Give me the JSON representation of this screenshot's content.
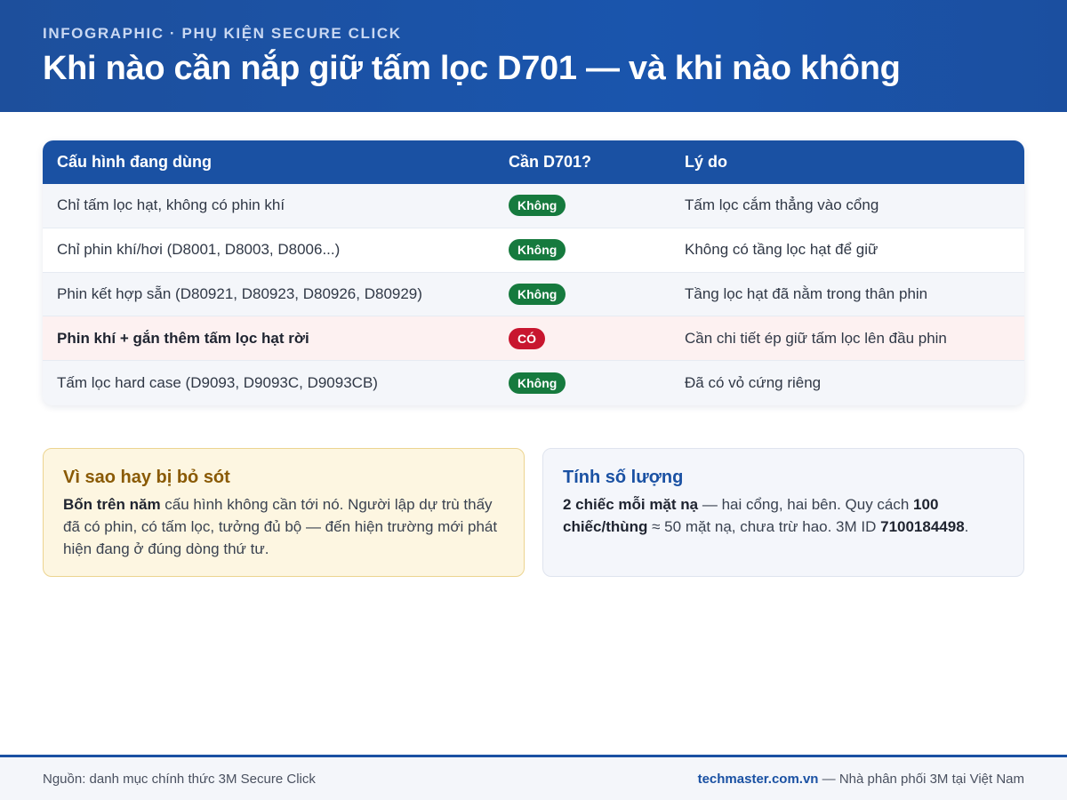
{
  "header": {
    "eyebrow": "INFOGRAPHIC · PHỤ KIỆN SECURE CLICK",
    "title": "Khi nào cần nắp giữ tấm lọc D701 — và khi nào không"
  },
  "table": {
    "headers": [
      "Cấu hình đang dùng",
      "Cần D701?",
      "Lý do"
    ],
    "rows": [
      {
        "config": "Chỉ tấm lọc hạt, không có phin khí",
        "need": "Không",
        "reason": "Tấm lọc cắm thẳng vào cổng"
      },
      {
        "config": "Chỉ phin khí/hơi (D8001, D8003, D8006...)",
        "need": "Không",
        "reason": "Không có tầng lọc hạt để giữ"
      },
      {
        "config": "Phin kết hợp sẵn (D80921, D80923, D80926, D80929)",
        "need": "Không",
        "reason": "Tầng lọc hạt đã nằm trong thân phin"
      },
      {
        "config": "Phin khí + gắn thêm tấm lọc hạt rời",
        "need": "CÓ",
        "reason": "Cần chi tiết ép giữ tấm lọc lên đầu phin"
      },
      {
        "config": "Tấm lọc hard case (D9093, D9093C, D9093CB)",
        "need": "Không",
        "reason": "Đã có vỏ cứng riêng"
      }
    ]
  },
  "warn_box": {
    "title": "Vì sao hay bị bỏ sót",
    "bold_lead": "Bốn trên năm",
    "text": " cấu hình không cần tới nó. Người lập dự trù thấy đã có phin, có tấm lọc, tưởng đủ bộ — đến hiện trường mới phát hiện đang ở đúng dòng thứ tư."
  },
  "info_box": {
    "title": "Tính số lượng",
    "bold_lead": "2 chiếc mỗi mặt nạ",
    "text_1": " — hai cổng, hai bên. Quy cách ",
    "bold_mid": "100 chiếc/thùng",
    "text_2": " ≈ 50 mặt nạ, chưa trừ hao. 3M ID ",
    "bold_id": "7100184498",
    "text_3": "."
  },
  "footer": {
    "source": "Nguồn: danh mục chính thức 3M Secure Click",
    "site": "techmaster.com.vn",
    "tagline": " — Nhà phân phối 3M tại Việt Nam"
  },
  "colors": {
    "brand": "#1a51a3",
    "no_badge": "#167a3e",
    "yes_badge": "#c8162f",
    "warn_bg": "#fdf6e1"
  }
}
